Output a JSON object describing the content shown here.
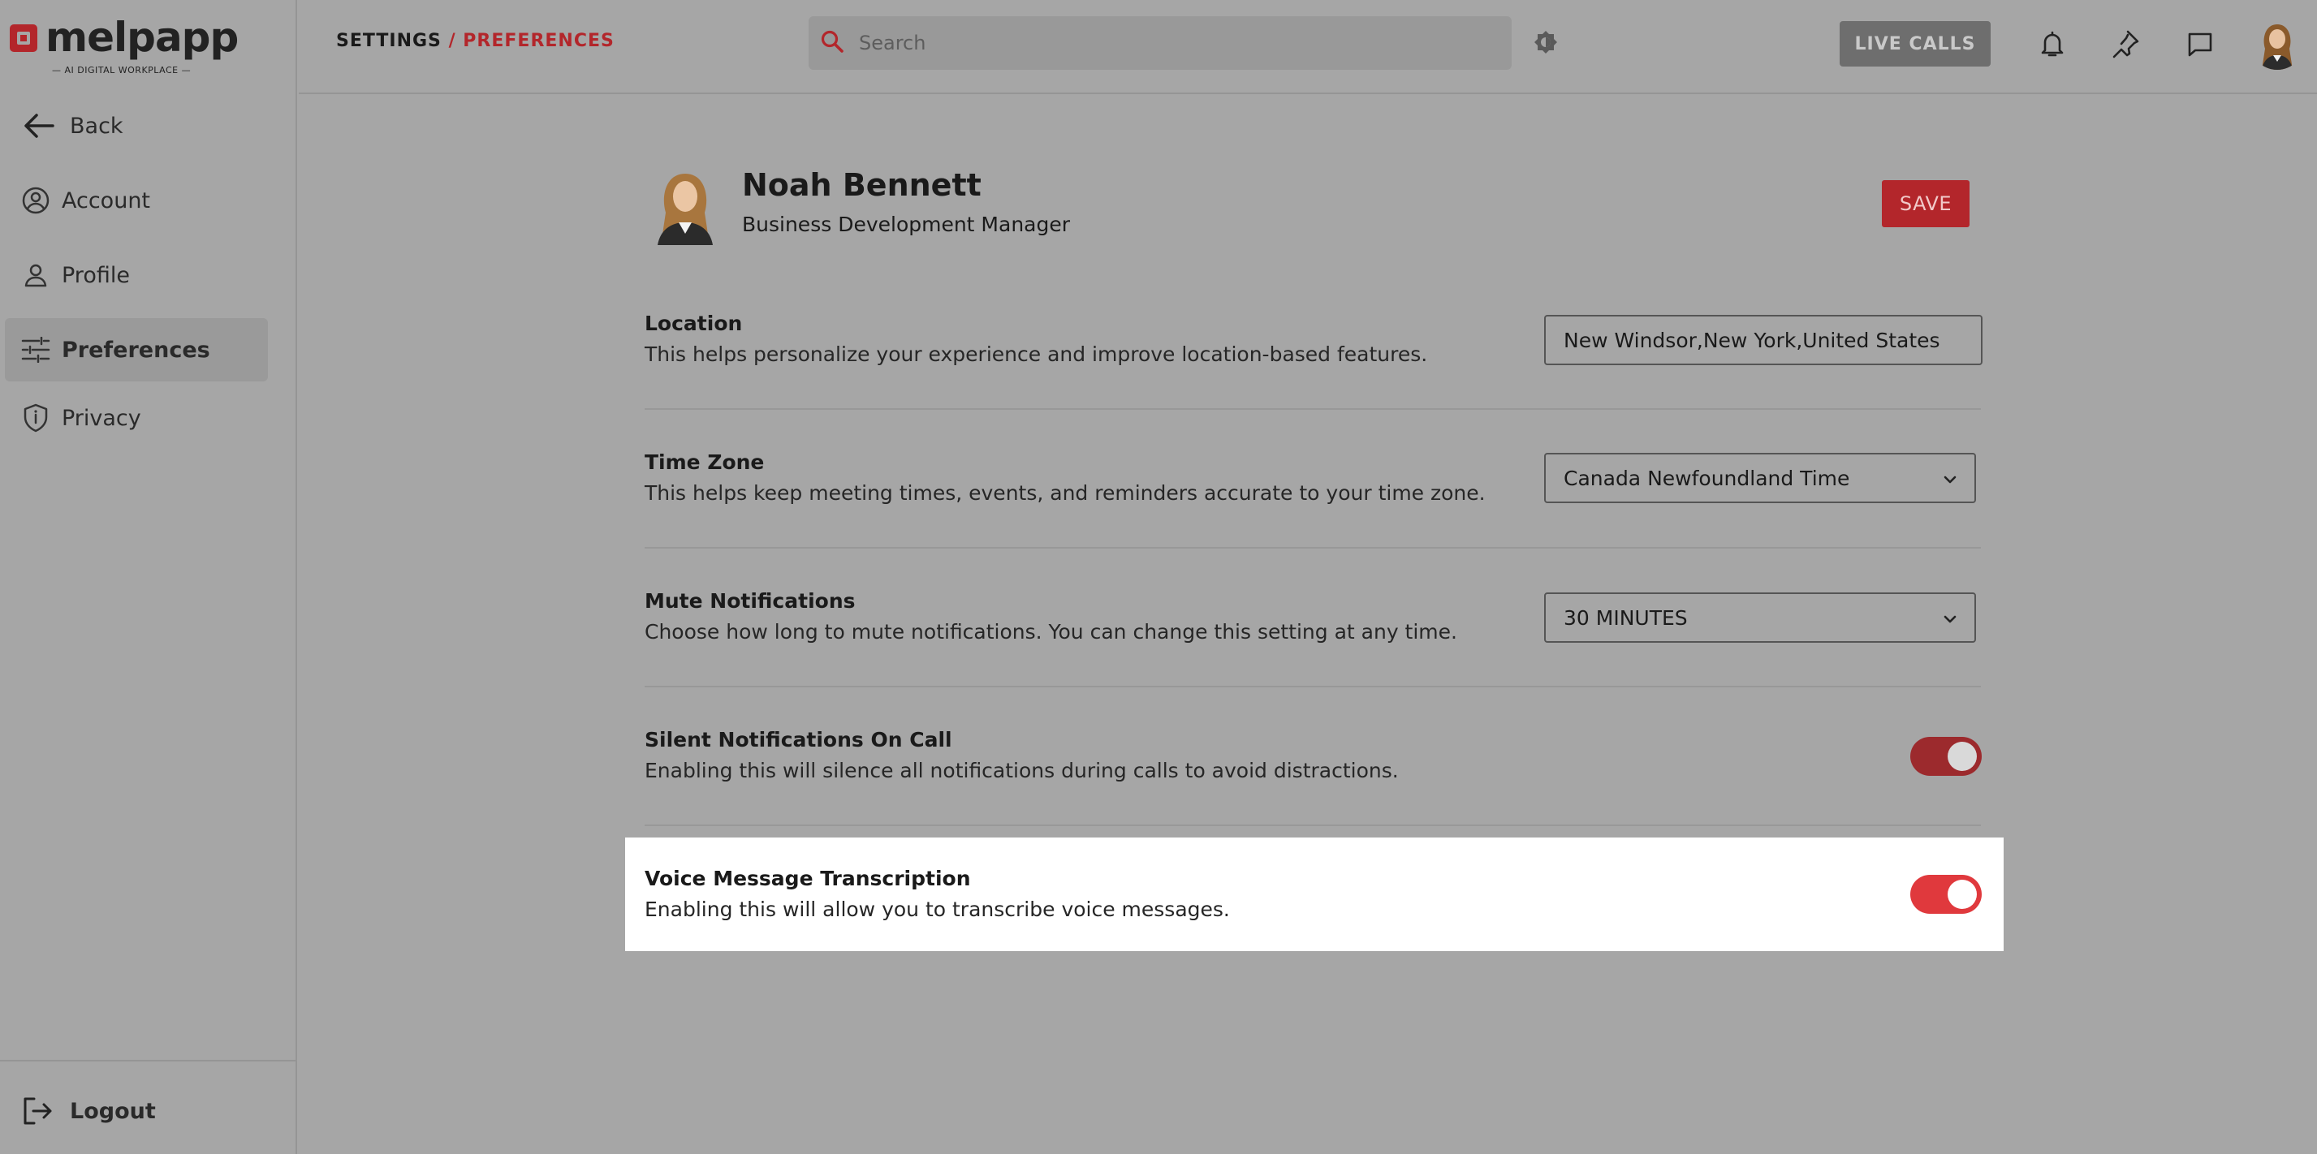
{
  "brand": {
    "name": "melpapp",
    "tagline": "— AI DIGITAL WORKPLACE —",
    "accent_color": "#b3262b"
  },
  "sidebar": {
    "back_label": "Back",
    "items": [
      {
        "label": "Account",
        "icon": "user-circle-icon"
      },
      {
        "label": "Profile",
        "icon": "person-icon"
      },
      {
        "label": "Preferences",
        "icon": "sliders-icon",
        "active": true
      },
      {
        "label": "Privacy",
        "icon": "shield-icon"
      }
    ],
    "logout_label": "Logout"
  },
  "header": {
    "breadcrumb_root": "SETTINGS",
    "breadcrumb_sep": "/",
    "breadcrumb_current": "PREFERENCES",
    "search_placeholder": "Search",
    "live_calls_label": "LIVE CALLS",
    "icons": [
      "search-icon",
      "theme-toggle-icon",
      "bell-icon",
      "pin-icon",
      "chat-icon"
    ]
  },
  "profile": {
    "name": "Noah Bennett",
    "title": "Business Development Manager",
    "save_label": "SAVE"
  },
  "settings": {
    "location": {
      "title": "Location",
      "description": "This helps personalize your experience and improve location-based features.",
      "value": "New Windsor,New York,United States"
    },
    "time_zone": {
      "title": "Time Zone",
      "description": "This helps keep meeting times, events, and reminders accurate to your time zone.",
      "value": "Canada Newfoundland Time"
    },
    "mute_notifications": {
      "title": "Mute Notifications",
      "description": "Choose how long to mute notifications. You can change this setting at any time.",
      "value": "30 MINUTES"
    },
    "silent_on_call": {
      "title": "Silent Notifications On Call",
      "description": "Enabling this will silence all notifications during calls to avoid distractions.",
      "enabled": true
    },
    "voice_transcription": {
      "title": "Voice Message Transcription",
      "description": "Enabling this will allow you to transcribe voice messages.",
      "enabled": true
    }
  }
}
